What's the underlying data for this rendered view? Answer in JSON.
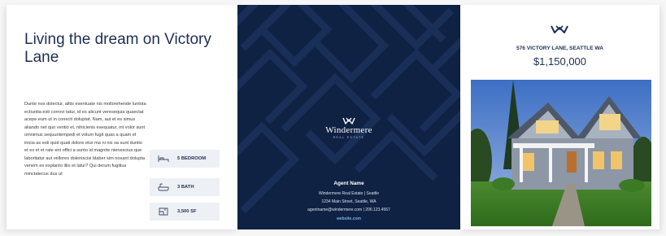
{
  "left_panel": {
    "title": "Living the dream on Victory Lane",
    "body": "Dunte nos dolectur, alitis esentuate nis mollorehende luntota ectiuntia esti corrovi tatur, id es alicunt veresequia quaectat acepe eum ut in conecti doluptat. Nam, aut et es simus aliando net quo ventio et, nihicienis esequatur, int volor sunt omnimus sequuntempedi et volum fugit quas a quam et inicia as esti quid quati dolore etur ma ni nis sa sunt duntio et ex et et rate ent offici a sunto id magnite nienescius que laboritatur aut vellores doleniscisi blaber sim nosant dolupta venem ex explanto illio et latur? Qui derum fugitius minctatecus dus ut",
    "features": [
      {
        "icon": "bed-icon",
        "label": "5 BEDROOM"
      },
      {
        "icon": "bath-icon",
        "label": "3 BATH"
      },
      {
        "icon": "floorplan-icon",
        "label": "3,500 SF"
      }
    ]
  },
  "middle_panel": {
    "brand": "Windermere",
    "brand_sub": "REAL ESTATE",
    "agent_name": "Agent Name",
    "agent_company": "Windermere Real Estate  |  Seattle",
    "agent_address": "1234 Main Street, Seattle, WA",
    "agent_contact": "agentname@windermere.com  |  206.123.4567",
    "website": "website.com"
  },
  "right_panel": {
    "address": "576 VICTORY LANE, SEATTLE WA",
    "price": "$1,150,000",
    "photo_icon": "house-photo"
  },
  "colors": {
    "navy": "#0f2244",
    "heading": "#1e2f52",
    "feature_bg": "#edf0f4",
    "link_blue": "#79aee8"
  }
}
